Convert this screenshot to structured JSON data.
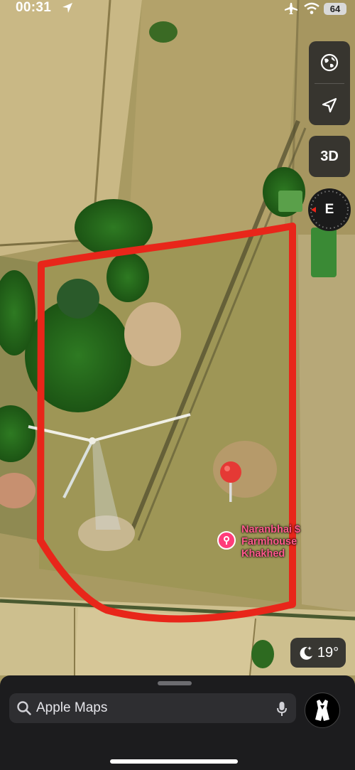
{
  "status_bar": {
    "time": "00:31",
    "battery": "64",
    "icons": [
      "location-arrow-icon",
      "airplane-icon",
      "wifi-icon",
      "battery-icon"
    ]
  },
  "map_controls": {
    "globe_icon": "globe-icon",
    "location_icon": "location-arrow-icon",
    "view_3d_label": "3D",
    "compass_heading": "E"
  },
  "poi": {
    "name_lines": [
      "Naranbhai $",
      "Farmhouse",
      "Khakhed"
    ],
    "icon": "key-pin-icon",
    "color": "#ff3d7a"
  },
  "drawn_boundary_color": "#e8261a",
  "weather": {
    "icon": "moon-stars-icon",
    "temperature": "19°"
  },
  "search": {
    "placeholder": "Apple Maps",
    "search_icon": "search-icon",
    "mic_icon": "microphone-icon"
  },
  "profile": {
    "icon": "avatar-icon"
  }
}
